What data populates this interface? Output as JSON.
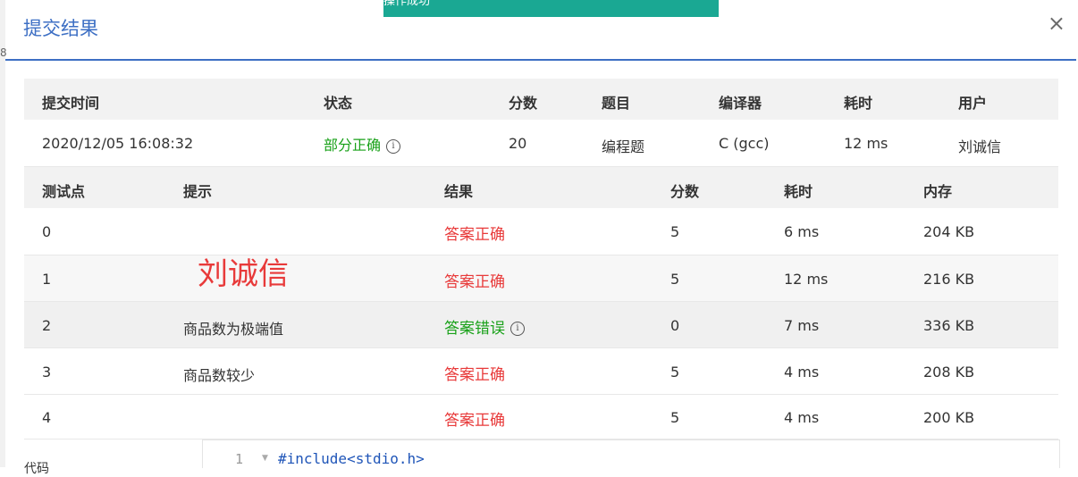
{
  "toast": {
    "text": "操作成功"
  },
  "dialog": {
    "title": "提交结果",
    "close": "×"
  },
  "left_edge": {
    "glyph": "8"
  },
  "summary": {
    "headers": [
      "提交时间",
      "状态",
      "分数",
      "题目",
      "编译器",
      "耗时",
      "用户"
    ],
    "row": {
      "time": "2020/12/05 16:08:32",
      "status": "部分正确",
      "score": "20",
      "problem": "编程题",
      "compiler": "C (gcc)",
      "duration": "12 ms",
      "user": "刘诚信"
    }
  },
  "tests": {
    "headers": [
      "测试点",
      "提示",
      "结果",
      "分数",
      "耗时",
      "内存"
    ],
    "rows": [
      {
        "id": "0",
        "hint": "",
        "result": "答案正确",
        "score": "5",
        "time": "6 ms",
        "memory": "204 KB"
      },
      {
        "id": "1",
        "hint": "",
        "result": "答案正确",
        "score": "5",
        "time": "12 ms",
        "memory": "216 KB"
      },
      {
        "id": "2",
        "hint": "商品数为极端值",
        "result": "答案错误",
        "score": "0",
        "time": "7 ms",
        "memory": "336 KB"
      },
      {
        "id": "3",
        "hint": "商品数较少",
        "result": "答案正确",
        "score": "5",
        "time": "4 ms",
        "memory": "208 KB"
      },
      {
        "id": "4",
        "hint": "",
        "result": "答案正确",
        "score": "5",
        "time": "4 ms",
        "memory": "200 KB"
      }
    ]
  },
  "watermark": "刘诚信",
  "code": {
    "label": "代码",
    "line_number": "1",
    "first_line": "#include<stdio.h>"
  },
  "colors": {
    "accent": "#3d6fc4",
    "toast": "#1aa893",
    "correct": "#e83a3a",
    "wrong": "#19a119"
  }
}
